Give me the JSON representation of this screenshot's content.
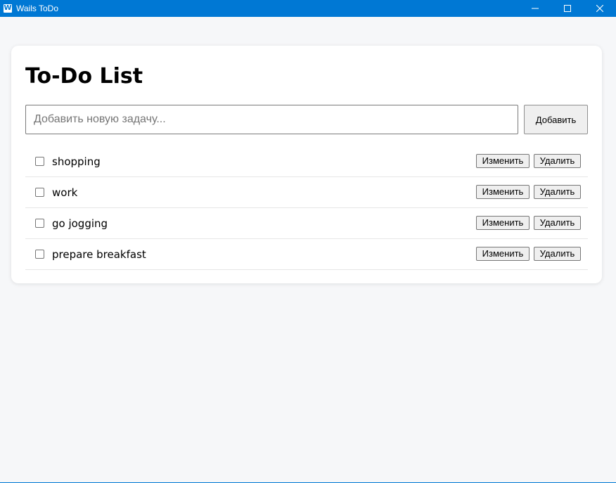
{
  "window": {
    "title": "Wails ToDo",
    "icon_letter": "W",
    "controls": [
      "minimize-icon",
      "maximize-icon",
      "close-icon"
    ]
  },
  "colors": {
    "titlebar": "#0078d4",
    "background": "#f6f7f9",
    "card": "#ffffff"
  },
  "main": {
    "title": "To-Do List",
    "input": {
      "placeholder": "Добавить новую задачу...",
      "value": ""
    },
    "add_label": "Добавить",
    "tasks": [
      {
        "label": "shopping",
        "done": false,
        "edit_label": "Изменить",
        "delete_label": "Удалить"
      },
      {
        "label": "work",
        "done": false,
        "edit_label": "Изменить",
        "delete_label": "Удалить"
      },
      {
        "label": "go jogging",
        "done": false,
        "edit_label": "Изменить",
        "delete_label": "Удалить"
      },
      {
        "label": "prepare breakfast",
        "done": false,
        "edit_label": "Изменить",
        "delete_label": "Удалить"
      }
    ]
  }
}
